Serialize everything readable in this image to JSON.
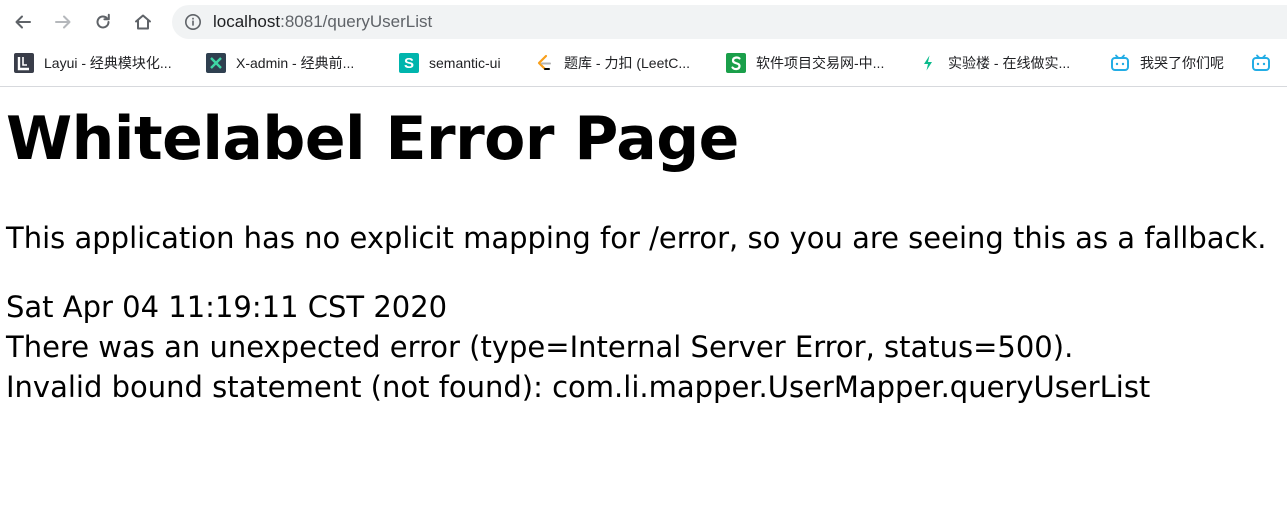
{
  "browser": {
    "url": {
      "host": "localhost",
      "rest": ":8081/queryUserList"
    },
    "icons": {
      "back": "back-arrow-icon",
      "forward": "forward-arrow-icon",
      "reload": "reload-icon",
      "home": "home-icon",
      "info": "info-icon"
    },
    "bookmarks": [
      {
        "label": "Layui - 经典模块化...",
        "icon": "layui-icon",
        "color": "#393D49"
      },
      {
        "label": "X-admin - 经典前...",
        "icon": "x-admin-icon",
        "color": "#2f4050"
      },
      {
        "label": "semantic-ui",
        "icon": "semantic-ui-icon",
        "color": "#00b5ad"
      },
      {
        "label": "题库 - 力扣 (LeetC...",
        "icon": "leetcode-icon",
        "color": "#f89f1b"
      },
      {
        "label": "软件项目交易网-中...",
        "icon": "proginn-icon",
        "color": "#1a9f4a"
      },
      {
        "label": "实验楼 - 在线做实...",
        "icon": "shiyanlou-icon",
        "color": "#0bbb8c"
      },
      {
        "label": "我哭了你们呢",
        "icon": "bilibili-icon",
        "color": "#23ade5"
      },
      {
        "label": "",
        "icon": "bilibili-icon",
        "color": "#23ade5"
      }
    ]
  },
  "page": {
    "title": "Whitelabel Error Page",
    "intro": "This application has no explicit mapping for /error, so you are seeing this as a fallback.",
    "timestamp": "Sat Apr 04 11:19:11 CST 2020",
    "error_line": "There was an unexpected error (type=Internal Server Error, status=500).",
    "detail": "Invalid bound statement (not found): com.li.mapper.UserMapper.queryUserList"
  }
}
